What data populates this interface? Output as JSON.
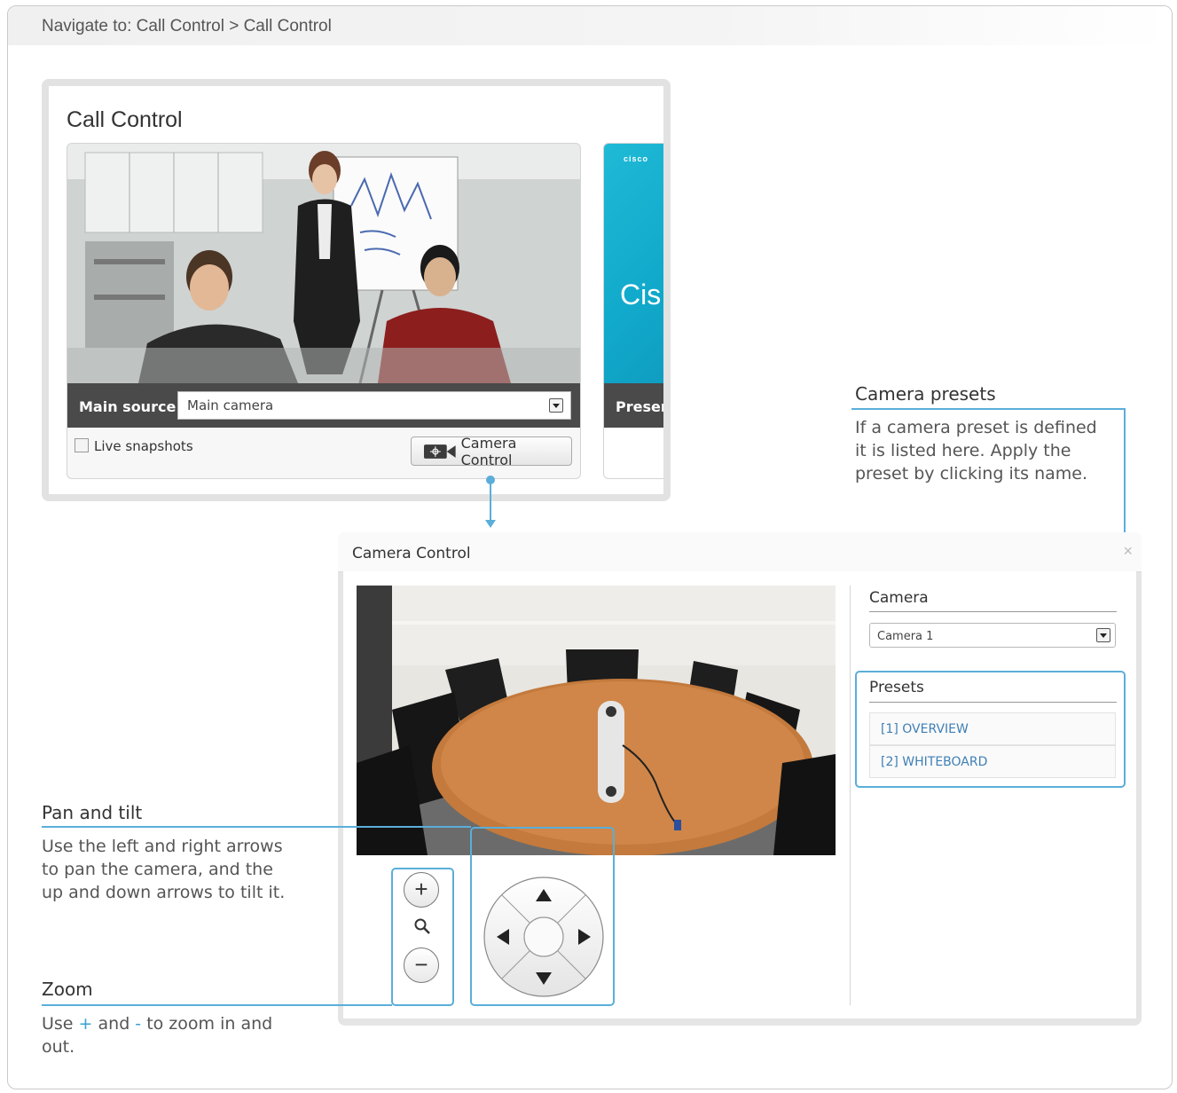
{
  "navigation": {
    "text": "Navigate to: Call Control > Call Control"
  },
  "call_control": {
    "title": "Call Control",
    "main_source_label": "Main source",
    "main_source_value": "Main camera",
    "live_snapshots_label": "Live snapshots",
    "camera_control_button": "Camera Control",
    "presentation_label": "Presen",
    "presentation_screen_text": "Cis",
    "cisco_logo_text": "cisco"
  },
  "callouts": {
    "camera_presets": {
      "title": "Camera presets",
      "text": "If a camera preset is defined it is listed here. Apply the preset by clicking its name."
    },
    "pan_tilt": {
      "title": "Pan and tilt",
      "text": "Use the left and right arrows to pan the camera, and the up and down arrows to tilt it."
    },
    "zoom": {
      "title": "Zoom",
      "text_before": "Use ",
      "plus": "+",
      "text_mid": " and ",
      "minus": "-",
      "text_after": " to zoom in and out."
    }
  },
  "camera_dialog": {
    "title": "Camera Control",
    "close_symbol": "×",
    "camera_label": "Camera",
    "camera_value": "Camera 1",
    "presets_label": "Presets",
    "presets": [
      "[1] OVERVIEW",
      "[2] WHITEBOARD"
    ],
    "zoom_in": "+",
    "zoom_out": "−"
  },
  "colors": {
    "accent": "#5aaed9",
    "preset_link": "#3f7fb5",
    "source_bar": "#4a4a4a"
  }
}
